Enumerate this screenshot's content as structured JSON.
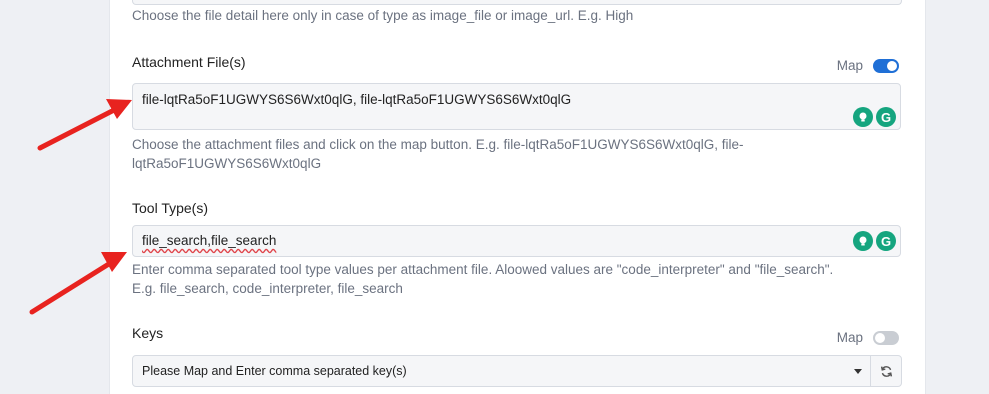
{
  "top_help": "Choose the file detail here only in case of type as image_file or image_url. E.g. High",
  "attachment": {
    "label": "Attachment File(s)",
    "map_label": "Map",
    "map_on": true,
    "value": "file-lqtRa5oF1UGWYS6S6Wxt0qlG, file-lqtRa5oF1UGWYS6S6Wxt0qlG",
    "help_line1": "Choose the attachment files and click on the map button. E.g. file-lqtRa5oF1UGWYS6S6Wxt0qlG, file-",
    "help_line2": "lqtRa5oF1UGWYS6S6Wxt0qlG"
  },
  "tool_type": {
    "label": "Tool Type(s)",
    "value": "file_search,file_search",
    "help_line1": "Enter comma separated tool type values per attachment file. Aloowed values are \"code_interpreter\" and \"file_search\".",
    "help_line2": "E.g. file_search, code_interpreter, file_search"
  },
  "keys": {
    "label": "Keys",
    "map_label": "Map",
    "map_on": false,
    "select_value": "Please Map and Enter comma separated key(s)"
  },
  "grammarly_letter": "G",
  "colors": {
    "accent": "#1f6fd6",
    "grammarly": "#15a57f",
    "annotation_arrow": "#e8231f"
  },
  "icons": [
    "lightbulb-icon",
    "grammarly-icon",
    "caret-down-icon",
    "refresh-icon",
    "red-arrow-icon"
  ]
}
